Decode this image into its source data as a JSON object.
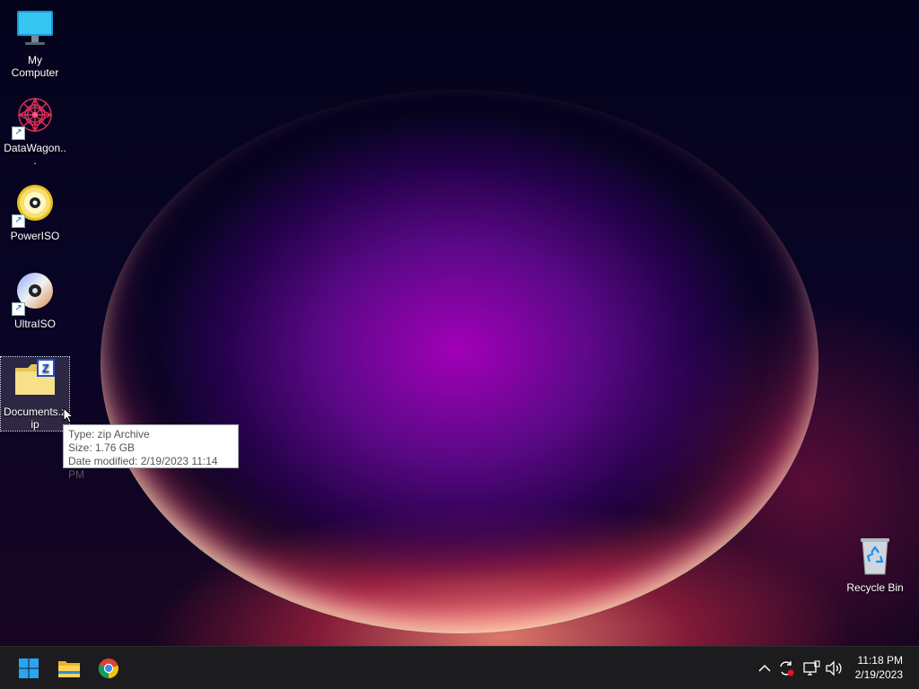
{
  "desktop": {
    "icons": [
      {
        "label": "My Computer",
        "icon": "monitor-icon"
      },
      {
        "label": "DataWagon...",
        "icon": "datawagon-icon",
        "shortcut": true
      },
      {
        "label": "PowerISO",
        "icon": "poweriso-disc-icon",
        "shortcut": true
      },
      {
        "label": "UltraISO",
        "icon": "ultraiso-disc-icon",
        "shortcut": true
      },
      {
        "label": "Documents.zip",
        "icon": "zip-folder-icon",
        "selected": true
      },
      {
        "label": "Recycle Bin",
        "icon": "recycle-bin-icon"
      }
    ],
    "tooltip": {
      "type": "Type: zip Archive",
      "size": "Size: 1.76 GB",
      "modified": "Date modified: 2/19/2023 11:14 PM"
    }
  },
  "taskbar": {
    "pinned": [
      {
        "name": "Start",
        "icon": "windows-start-icon"
      },
      {
        "name": "File Explorer",
        "icon": "file-explorer-icon"
      },
      {
        "name": "Google Chrome",
        "icon": "chrome-icon"
      }
    ],
    "tray_icons": [
      "chevron-up-icon",
      "sync-error-icon",
      "network-icon",
      "volume-icon"
    ],
    "clock": {
      "time": "11:18 PM",
      "date": "2/19/2023"
    }
  },
  "colors": {
    "taskbar_bg": "#1c1c1e",
    "accent_blue": "#1a8cff"
  }
}
